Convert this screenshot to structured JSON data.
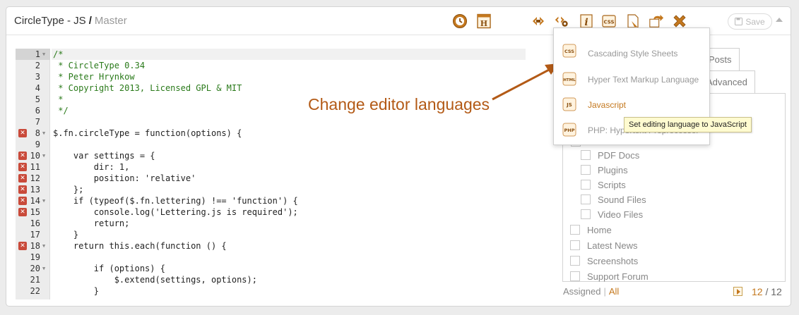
{
  "header": {
    "title": "CircleType - JS",
    "separator": "/",
    "breadcrumb": "Master",
    "save_label": "Save"
  },
  "toolbar": {
    "icons": [
      "history-icon",
      "html-header-icon",
      "code-icon",
      "code-settings-icon",
      "info-icon",
      "css-icon",
      "document-icon",
      "move-icon",
      "close-icon"
    ]
  },
  "editor": {
    "lines": [
      {
        "num": "1",
        "fold": true,
        "error": false,
        "text": "/*",
        "cls": "c-comment"
      },
      {
        "num": "2",
        "fold": false,
        "error": false,
        "text": " * CircleType 0.34",
        "cls": "c-comment"
      },
      {
        "num": "3",
        "fold": false,
        "error": false,
        "text": " * Peter Hrynkow",
        "cls": "c-comment"
      },
      {
        "num": "4",
        "fold": false,
        "error": false,
        "text": " * Copyright 2013, Licensed GPL & MIT",
        "cls": "c-comment"
      },
      {
        "num": "5",
        "fold": false,
        "error": false,
        "text": " *",
        "cls": "c-comment"
      },
      {
        "num": "6",
        "fold": false,
        "error": false,
        "text": " */",
        "cls": "c-comment"
      },
      {
        "num": "7",
        "fold": false,
        "error": false,
        "text": "",
        "cls": ""
      },
      {
        "num": "8",
        "fold": true,
        "error": true,
        "text": "$.fn.circleType = function(options) {",
        "cls": ""
      },
      {
        "num": "9",
        "fold": false,
        "error": false,
        "text": "",
        "cls": ""
      },
      {
        "num": "10",
        "fold": true,
        "error": true,
        "text": "    var settings = {",
        "cls": ""
      },
      {
        "num": "11",
        "fold": false,
        "error": true,
        "text": "        dir: 1,",
        "cls": ""
      },
      {
        "num": "12",
        "fold": false,
        "error": true,
        "text": "        position: 'relative'",
        "cls": ""
      },
      {
        "num": "13",
        "fold": false,
        "error": true,
        "text": "    };",
        "cls": ""
      },
      {
        "num": "14",
        "fold": true,
        "error": true,
        "text": "    if (typeof($.fn.lettering) !== 'function') {",
        "cls": ""
      },
      {
        "num": "15",
        "fold": false,
        "error": true,
        "text": "        console.log('Lettering.js is required');",
        "cls": ""
      },
      {
        "num": "16",
        "fold": false,
        "error": false,
        "text": "        return;",
        "cls": ""
      },
      {
        "num": "17",
        "fold": false,
        "error": false,
        "text": "    }",
        "cls": ""
      },
      {
        "num": "18",
        "fold": true,
        "error": true,
        "text": "    return this.each(function () {",
        "cls": ""
      },
      {
        "num": "19",
        "fold": false,
        "error": false,
        "text": "",
        "cls": ""
      },
      {
        "num": "20",
        "fold": true,
        "error": false,
        "text": "        if (options) {",
        "cls": ""
      },
      {
        "num": "21",
        "fold": false,
        "error": false,
        "text": "            $.extend(settings, options);",
        "cls": ""
      },
      {
        "num": "22",
        "fold": false,
        "error": false,
        "text": "        }",
        "cls": ""
      }
    ]
  },
  "language_menu": {
    "items": [
      {
        "icon_label": "CSS",
        "label": "Cascading Style Sheets",
        "highlight": false
      },
      {
        "icon_label": "HTML",
        "label": "Hyper Text Markup Language",
        "highlight": false
      },
      {
        "icon_label": "JS",
        "label": "Javascript",
        "highlight": true
      },
      {
        "icon_label": "PHP",
        "label": "PHP: Hypertext Preprocessor",
        "highlight": false
      }
    ],
    "tooltip": "Set editing language to JavaScript"
  },
  "annotation": "Change editor languages",
  "side_panel": {
    "tabs": [
      "Posts",
      "Advanced"
    ],
    "sub_items": [
      "PDF Docs",
      "Plugins",
      "Scripts",
      "Sound Files",
      "Video Files"
    ],
    "items": [
      "Home",
      "Latest News",
      "Screenshots",
      "Support Forum"
    ],
    "footer_assigned": "Assigned",
    "footer_sep": "|",
    "footer_all": "All",
    "count_current": "12",
    "count_sep": "/",
    "count_total": "12"
  },
  "colors": {
    "accent": "#c4781e",
    "error": "#c94a3a",
    "comment": "#2a7a1a"
  }
}
